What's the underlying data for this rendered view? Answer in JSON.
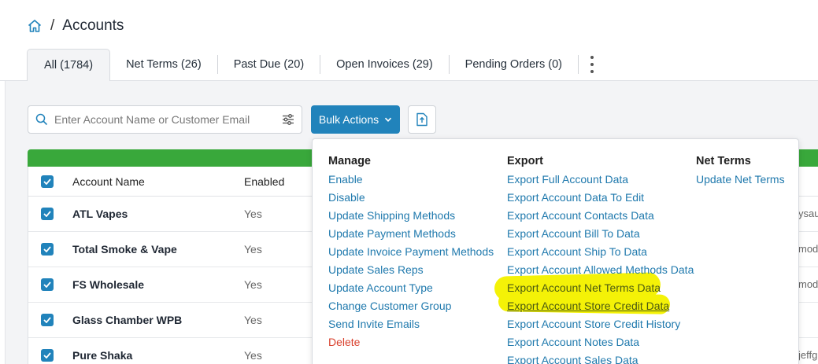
{
  "breadcrumb": {
    "separator": "/",
    "title": "Accounts"
  },
  "tabs": [
    {
      "label": "All (1784)"
    },
    {
      "label": "Net Terms (26)"
    },
    {
      "label": "Past Due (20)"
    },
    {
      "label": "Open Invoices (29)"
    },
    {
      "label": "Pending Orders (0)"
    }
  ],
  "search": {
    "placeholder": "Enter Account Name or Customer Email",
    "value": ""
  },
  "bulk_actions": {
    "label": "Bulk Actions"
  },
  "table": {
    "headers": {
      "name": "Account Name",
      "enabled": "Enabled"
    },
    "rows": [
      {
        "name": "ATL Vapes",
        "enabled": "Yes",
        "cut": "ysau"
      },
      {
        "name": "Total Smoke & Vape",
        "enabled": "Yes",
        "cut": "mod"
      },
      {
        "name": "FS Wholesale",
        "enabled": "Yes",
        "cut": "mod"
      },
      {
        "name": "Glass Chamber WPB",
        "enabled": "Yes",
        "cut": ""
      },
      {
        "name": "Pure Shaka",
        "enabled": "Yes",
        "cut": "jeffg"
      }
    ]
  },
  "menu": {
    "manage": {
      "heading": "Manage",
      "items": [
        "Enable",
        "Disable",
        "Update Shipping Methods",
        "Update Payment Methods",
        "Update Invoice Payment Methods",
        "Update Sales Reps",
        "Update Account Type",
        "Change Customer Group",
        "Send Invite Emails",
        "Delete"
      ]
    },
    "export": {
      "heading": "Export",
      "items": [
        "Export Full Account Data",
        "Export Account Data To Edit",
        "Export Account Contacts Data",
        "Export Account Bill To Data",
        "Export Account Ship To Data",
        "Export Account Allowed Methods Data",
        "Export Account Net Terms Data",
        "Export Account Store Credit Data",
        "Export Account Store Credit History",
        "Export Account Notes Data",
        "Export Account Sales Data"
      ]
    },
    "net_terms": {
      "heading": "Net Terms",
      "items": [
        "Update Net Terms"
      ]
    }
  },
  "colors": {
    "primary": "#2183bb",
    "success_bar": "#39a83b",
    "link": "#1f79ad",
    "danger": "#d9412e",
    "highlight": "#f4f207"
  }
}
